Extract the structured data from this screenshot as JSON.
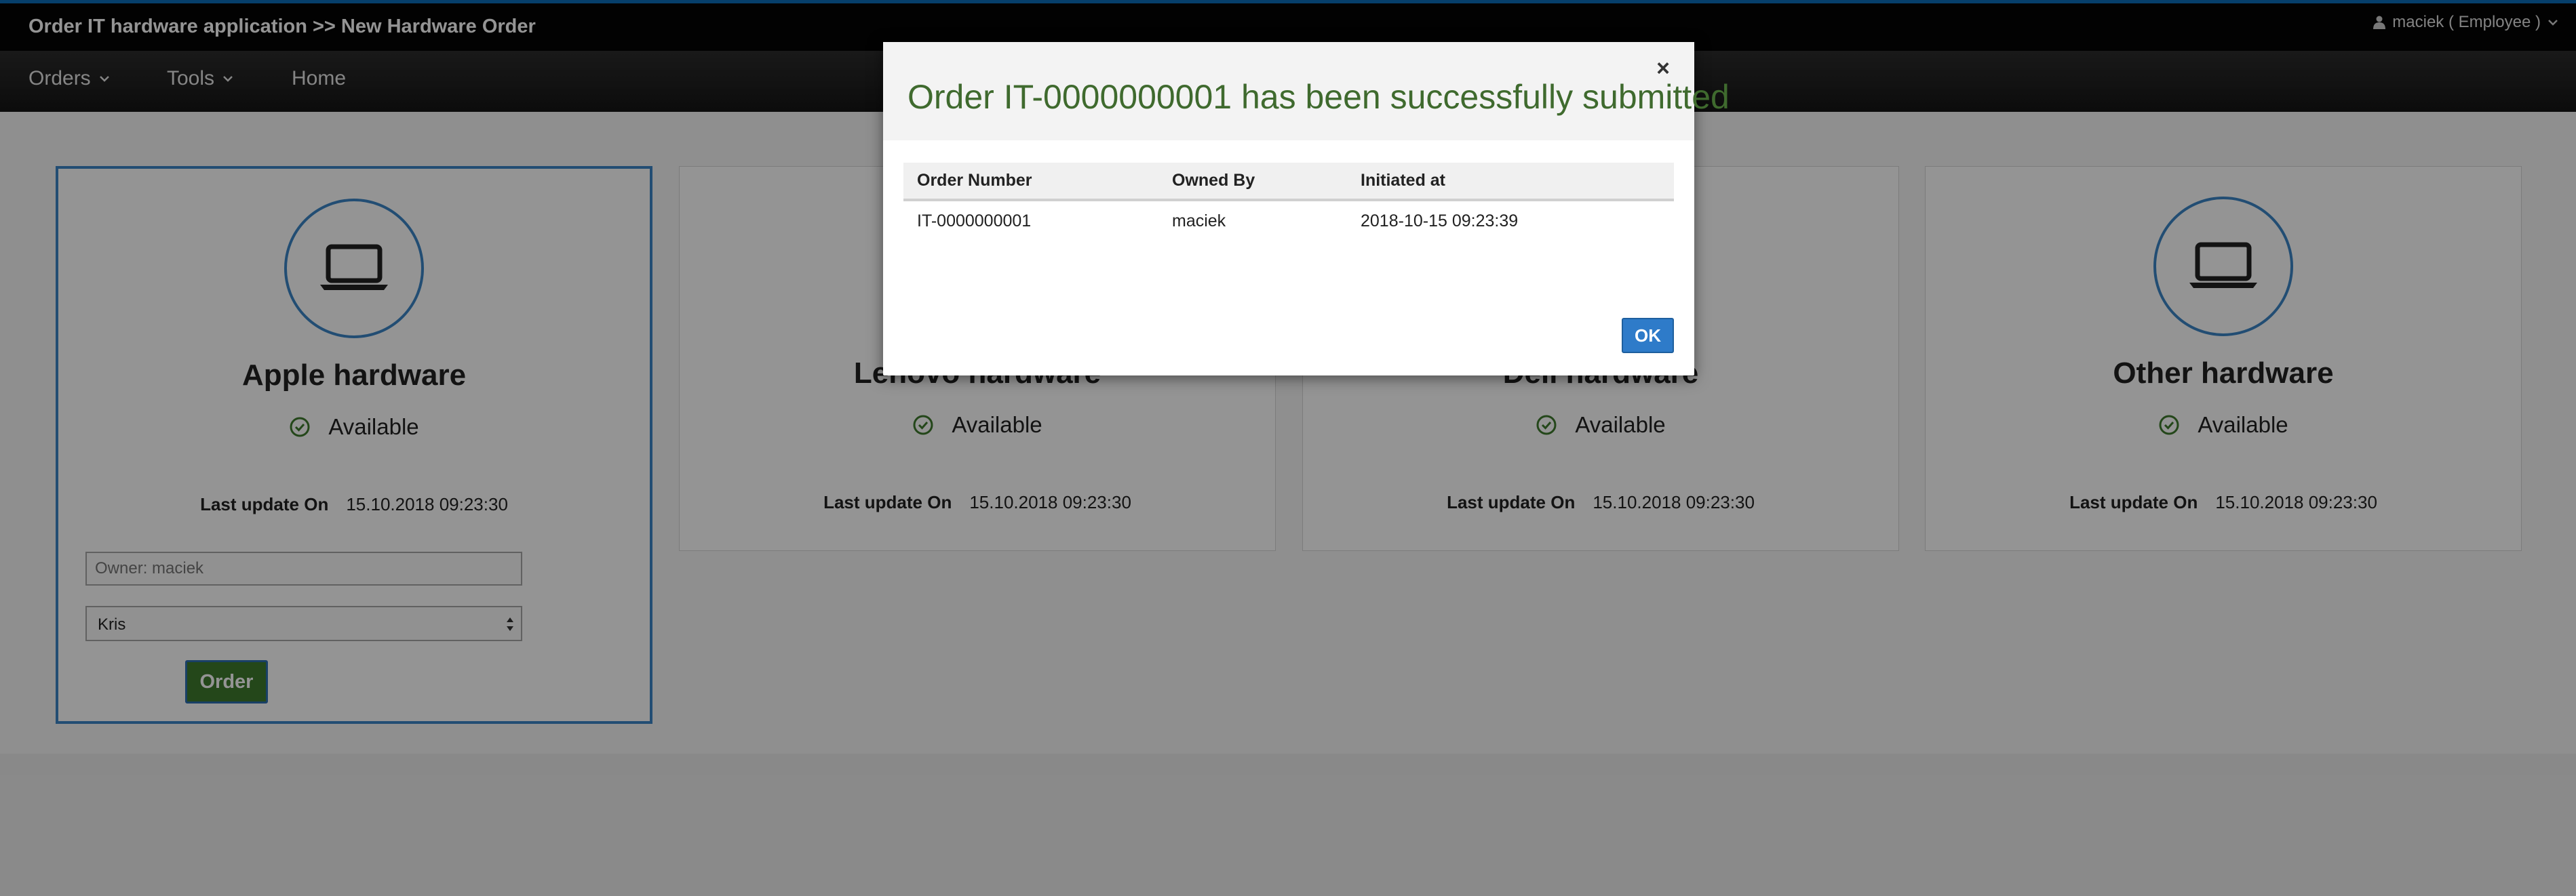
{
  "header": {
    "app_title": "Order IT hardware application >> New Hardware Order",
    "user_label": "maciek ( Employee )"
  },
  "nav": [
    {
      "label": "Orders",
      "has_dropdown": true
    },
    {
      "label": "Tools",
      "has_dropdown": true
    },
    {
      "label": "Home",
      "has_dropdown": false
    }
  ],
  "cards": [
    {
      "title": "Apple hardware",
      "status": "Available",
      "last_update_label": "Last update On",
      "last_update": "15.10.2018 09:23:30",
      "icon": "laptop-icon",
      "selected": true
    },
    {
      "title": "Lenovo hardware",
      "status": "Available",
      "last_update_label": "Last update On",
      "last_update": "15.10.2018 09:23:30",
      "icon": "laptop-icon"
    },
    {
      "title": "Dell hardware",
      "status": "Available",
      "last_update_label": "Last update On",
      "last_update": "15.10.2018 09:23:30",
      "icon": "laptop-icon"
    },
    {
      "title": "Other hardware",
      "status": "Available",
      "last_update_label": "Last update On",
      "last_update": "15.10.2018 09:23:30",
      "icon": "laptop-icon"
    }
  ],
  "order_form": {
    "owner_placeholder": "Owner: maciek",
    "approver_selected": "Kris",
    "order_label": "Order"
  },
  "modal": {
    "title": "Order IT-0000000001 has been successfully submitted",
    "close_symbol": "×",
    "columns": [
      "Order Number",
      "Owned By",
      "Initiated at"
    ],
    "rows": [
      [
        "IT-0000000001",
        "maciek",
        "2018-10-15 09:23:39"
      ]
    ],
    "ok_label": "OK"
  },
  "colors": {
    "accent": "#3b86c6",
    "success": "#3f6a2e",
    "order_button": "#3f7a2e",
    "topbar": "#050505"
  }
}
